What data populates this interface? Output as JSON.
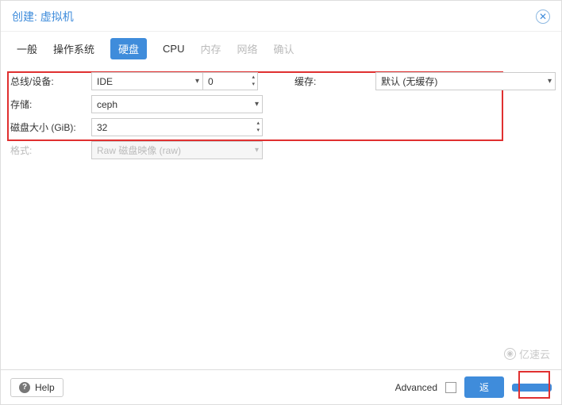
{
  "header": {
    "title": "创建: 虚拟机"
  },
  "tabs": {
    "general": "一般",
    "os": "操作系统",
    "disk": "硬盘",
    "cpu": "CPU",
    "memory": "内存",
    "network": "网络",
    "confirm": "确认"
  },
  "form": {
    "bus_label": "总线/设备:",
    "bus_value": "IDE",
    "device_number": "0",
    "cache_label": "缓存:",
    "cache_value": "默认 (无缓存)",
    "storage_label": "存储:",
    "storage_value": "ceph",
    "disk_size_label": "磁盘大小 (GiB):",
    "disk_size_value": "32",
    "format_label": "格式:",
    "format_value": "Raw 磁盘映像 (raw)"
  },
  "footer": {
    "help": "Help",
    "advanced": "Advanced",
    "back": "返",
    "next": ""
  },
  "watermark": "亿速云"
}
